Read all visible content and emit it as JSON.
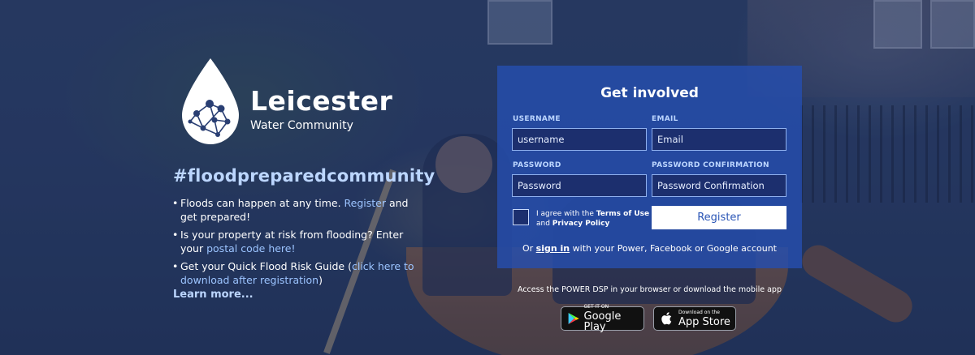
{
  "logo": {
    "title": "Leicester",
    "subtitle": "Water Community"
  },
  "hashtag": "#floodpreparedcommunity",
  "bullets": [
    {
      "text_before": "Floods can happen at any time. ",
      "link": "Register",
      "text_after": " and get prepared!"
    },
    {
      "text_before": "Is your property at risk from flooding? Enter your ",
      "link": "postal code here!",
      "text_after": ""
    },
    {
      "text_before": "Get your Quick Flood Risk Guide (",
      "link": "click here to download after registration",
      "text_after": ")"
    }
  ],
  "learn_more": "Learn more...",
  "form": {
    "title": "Get involved",
    "username_label": "USERNAME",
    "username_placeholder": "username",
    "email_label": "EMAIL",
    "email_placeholder": "Email",
    "password_label": "PASSWORD",
    "password_placeholder": "Password",
    "password_confirm_label": "PASSWORD CONFIRMATION",
    "password_confirm_placeholder": "Password Confirmation",
    "agree_prefix": "I agree with the ",
    "terms_link": "Terms of Use",
    "agree_and": " and ",
    "privacy_link": "Privacy Policy",
    "register_label": "Register",
    "signin_prefix": "Or ",
    "signin_link": "sign in",
    "signin_suffix": " with your Power, Facebook or Google account"
  },
  "access_text": "Access the POWER DSP in your browser or download the mobile app",
  "stores": {
    "google_small": "GET IT ON",
    "google_big": "Google Play",
    "apple_small": "Download on the",
    "apple_big": "App Store"
  },
  "colors": {
    "panel": "#264eaf",
    "accent_text": "#bcd6ff",
    "link": "#9cc4ff"
  }
}
